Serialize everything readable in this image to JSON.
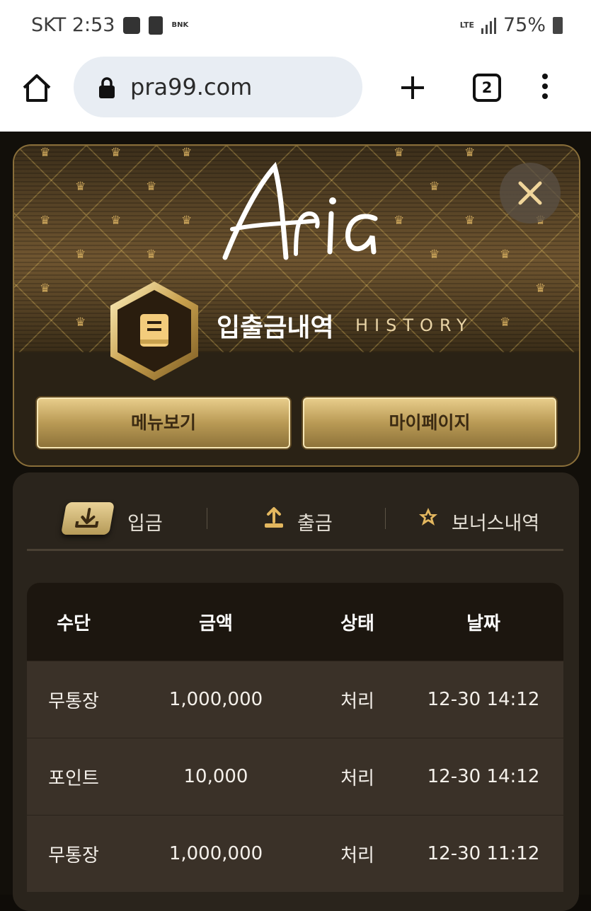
{
  "status_bar": {
    "carrier_time": "SKT 2:53",
    "bank_badge": "BNK",
    "network": "LTE",
    "battery": "75%"
  },
  "browser": {
    "url": "pra99.com",
    "tab_count": "2"
  },
  "header": {
    "logo_text": "Aria",
    "title": "입출금내역",
    "subtitle": "HISTORY",
    "menu_button": "메뉴보기",
    "mypage_button": "마이페이지"
  },
  "tabs": [
    {
      "label": "입금",
      "icon": "download-icon",
      "active": true
    },
    {
      "label": "출금",
      "icon": "upload-icon",
      "active": false
    },
    {
      "label": "보너스내역",
      "icon": "star-icon",
      "active": false
    }
  ],
  "table": {
    "columns": [
      "수단",
      "금액",
      "상태",
      "날짜"
    ],
    "rows": [
      [
        "무통장",
        "1,000,000",
        "처리",
        "12-30 14:12"
      ],
      [
        "포인트",
        "10,000",
        "처리",
        "12-30 14:12"
      ],
      [
        "무통장",
        "1,000,000",
        "처리",
        "12-30 11:12"
      ]
    ]
  },
  "colors": {
    "accent_gold": "#caa45a",
    "panel": "#2a241c",
    "row": "#3a3128",
    "header": "#1c160f"
  }
}
